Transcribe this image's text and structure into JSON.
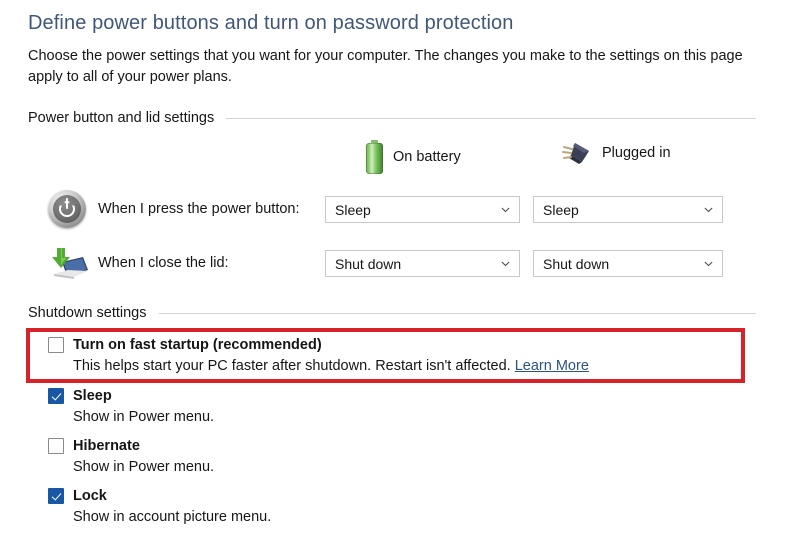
{
  "page": {
    "title": "Define power buttons and turn on password protection",
    "description": "Choose the power settings that you want for your computer. The changes you make to the settings on this page apply to all of your power plans."
  },
  "power_group": {
    "label": "Power button and lid settings",
    "columns": [
      {
        "icon": "battery-icon",
        "label": "On battery"
      },
      {
        "icon": "plug-icon",
        "label": "Plugged in"
      }
    ],
    "rows": [
      {
        "icon": "power-button-icon",
        "label": "When I press the power button:",
        "on_battery": "Sleep",
        "plugged_in": "Sleep"
      },
      {
        "icon": "laptop-lid-icon",
        "label": "When I close the lid:",
        "on_battery": "Shut down",
        "plugged_in": "Shut down"
      }
    ]
  },
  "shutdown_group": {
    "label": "Shutdown settings",
    "options": [
      {
        "title": "Turn on fast startup (recommended)",
        "checked": false,
        "description_prefix": "This helps start your PC faster after shutdown. Restart isn't affected. ",
        "link_label": "Learn More",
        "highlighted": true
      },
      {
        "title": "Sleep",
        "checked": true,
        "description": "Show in Power menu."
      },
      {
        "title": "Hibernate",
        "checked": false,
        "description": "Show in Power menu."
      },
      {
        "title": "Lock",
        "checked": true,
        "description": "Show in account picture menu."
      }
    ]
  },
  "colors": {
    "title": "#40577a",
    "highlight_border": "#d8222a",
    "checkbox_checked": "#1857a4",
    "link": "#2b5481",
    "battery_green": "#7cc25f"
  }
}
